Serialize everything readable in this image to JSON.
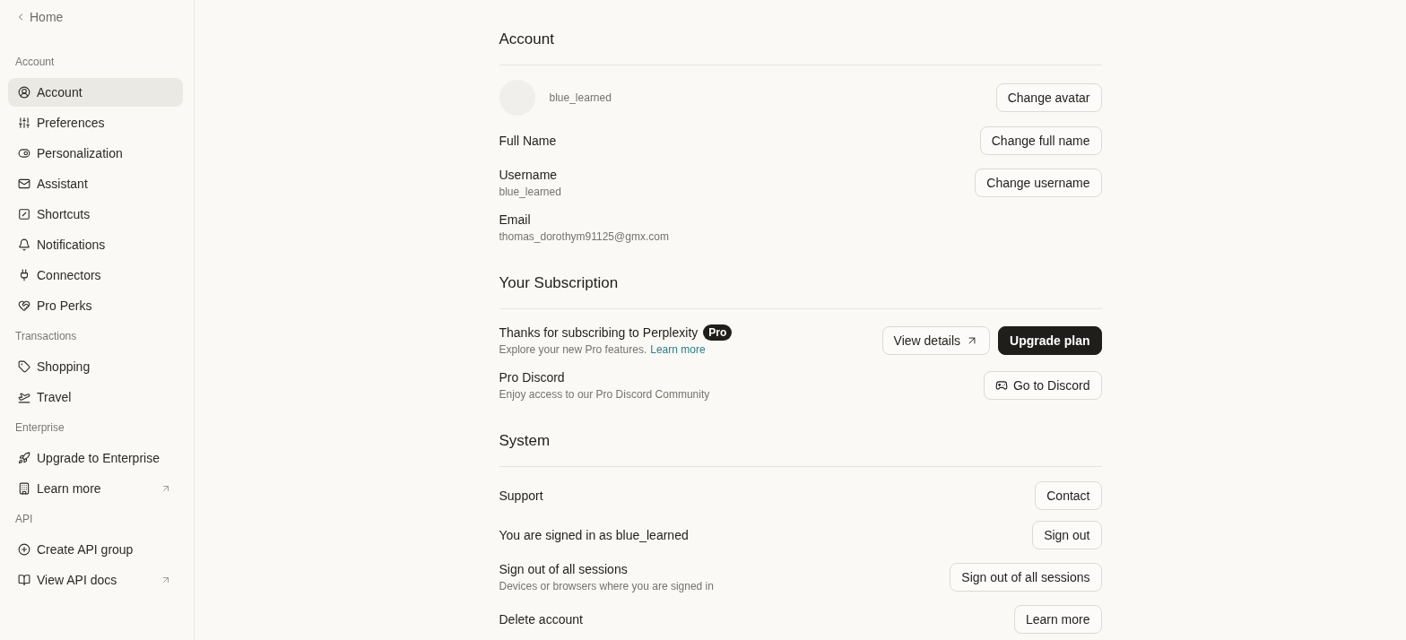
{
  "sidebar": {
    "back_link": {
      "label": "Home"
    },
    "sections": [
      {
        "title": "Account",
        "items": [
          {
            "label": "Account",
            "selected": true,
            "external": false
          },
          {
            "label": "Preferences",
            "selected": false,
            "external": false
          },
          {
            "label": "Personalization",
            "selected": false,
            "external": false
          },
          {
            "label": "Assistant",
            "selected": false,
            "external": false
          },
          {
            "label": "Shortcuts",
            "selected": false,
            "external": false
          },
          {
            "label": "Notifications",
            "selected": false,
            "external": false
          },
          {
            "label": "Connectors",
            "selected": false,
            "external": false
          },
          {
            "label": "Pro Perks",
            "selected": false,
            "external": false
          }
        ]
      },
      {
        "title": "Transactions",
        "items": [
          {
            "label": "Shopping",
            "selected": false,
            "external": false
          },
          {
            "label": "Travel",
            "selected": false,
            "external": false
          }
        ]
      },
      {
        "title": "Enterprise",
        "items": [
          {
            "label": "Upgrade to Enterprise",
            "selected": false,
            "external": false
          },
          {
            "label": "Learn more",
            "selected": false,
            "external": true
          }
        ]
      },
      {
        "title": "API",
        "items": [
          {
            "label": "Create API group",
            "selected": false,
            "external": false
          },
          {
            "label": "View API docs",
            "selected": false,
            "external": true
          }
        ]
      }
    ]
  },
  "main": {
    "sections": [
      {
        "title": "Account",
        "rows": [
          {
            "kind": "avatar",
            "value": "blue_learned",
            "buttons": [
              {
                "label": "Change avatar",
                "kind": "outline"
              }
            ]
          },
          {
            "kind": "field",
            "label": "Full Name",
            "buttons": [
              {
                "label": "Change full name",
                "kind": "outline"
              }
            ]
          },
          {
            "kind": "field",
            "label": "Username",
            "value": "blue_learned",
            "buttons": [
              {
                "label": "Change username",
                "kind": "outline"
              }
            ]
          },
          {
            "kind": "field",
            "label": "Email",
            "value": "thomas_dorothym91125@gmx.com"
          }
        ]
      },
      {
        "title": "Your Subscription",
        "rows": [
          {
            "kind": "field",
            "label": "Thanks for subscribing to Perplexity",
            "badge": "Pro",
            "value": "Explore your new Pro features.",
            "link": "Learn more",
            "buttons": [
              {
                "label": "View details",
                "kind": "outline",
                "external": true
              },
              {
                "label": "Upgrade plan",
                "kind": "primary"
              }
            ]
          },
          {
            "kind": "field",
            "label": "Pro Discord",
            "value": "Enjoy access to our Pro Discord Community",
            "buttons": [
              {
                "label": "Go to Discord",
                "kind": "outline",
                "leading_icon": true
              }
            ]
          }
        ]
      },
      {
        "title": "System",
        "rows": [
          {
            "kind": "field",
            "label": "Support",
            "buttons": [
              {
                "label": "Contact",
                "kind": "outline"
              }
            ]
          },
          {
            "kind": "field",
            "label": "You are signed in as blue_learned",
            "buttons": [
              {
                "label": "Sign out",
                "kind": "outline"
              }
            ]
          },
          {
            "kind": "field",
            "label": "Sign out of all sessions",
            "value": "Devices or browsers where you are signed in",
            "buttons": [
              {
                "label": "Sign out of all sessions",
                "kind": "outline"
              }
            ]
          },
          {
            "kind": "field",
            "label": "Delete account",
            "buttons": [
              {
                "label": "Learn more",
                "kind": "outline"
              }
            ]
          }
        ]
      }
    ]
  }
}
